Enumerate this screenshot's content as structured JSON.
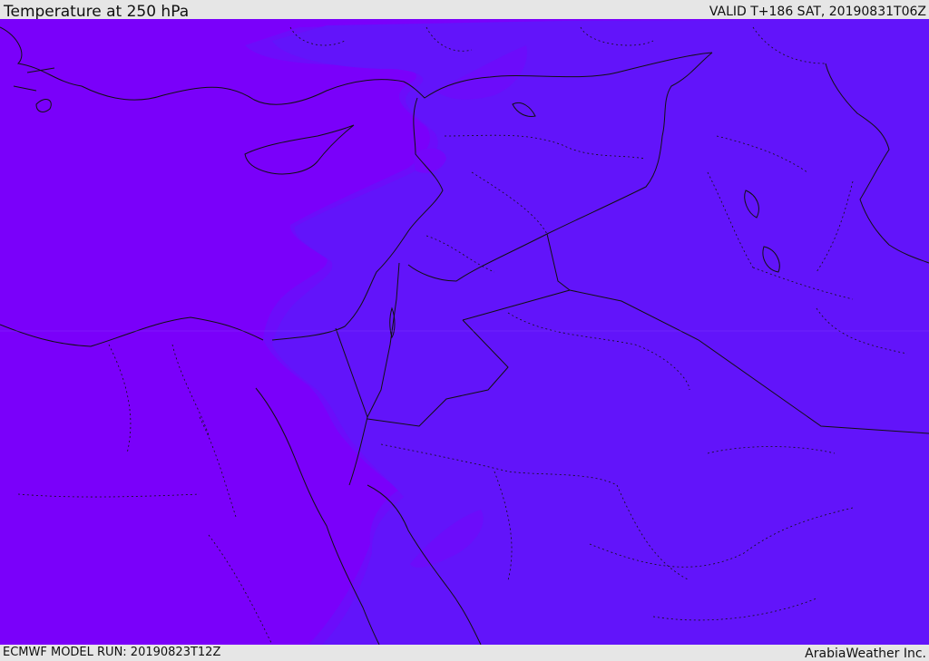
{
  "header": {
    "title": "Temperature at 250 hPa",
    "valid_time": "VALID T+186 SAT, 20190831T06Z"
  },
  "footer": {
    "model_run": "ECMWF MODEL RUN: 20190823T12Z",
    "credit": "ArabiaWeather Inc."
  },
  "map": {
    "field": "temperature",
    "level": "250 hPa",
    "colors": {
      "warm_zone": "#7a00fa",
      "cool_zone": "#6214fa",
      "transition": "#6c0cfa",
      "coastline": "#111111",
      "border": "#111111"
    }
  }
}
